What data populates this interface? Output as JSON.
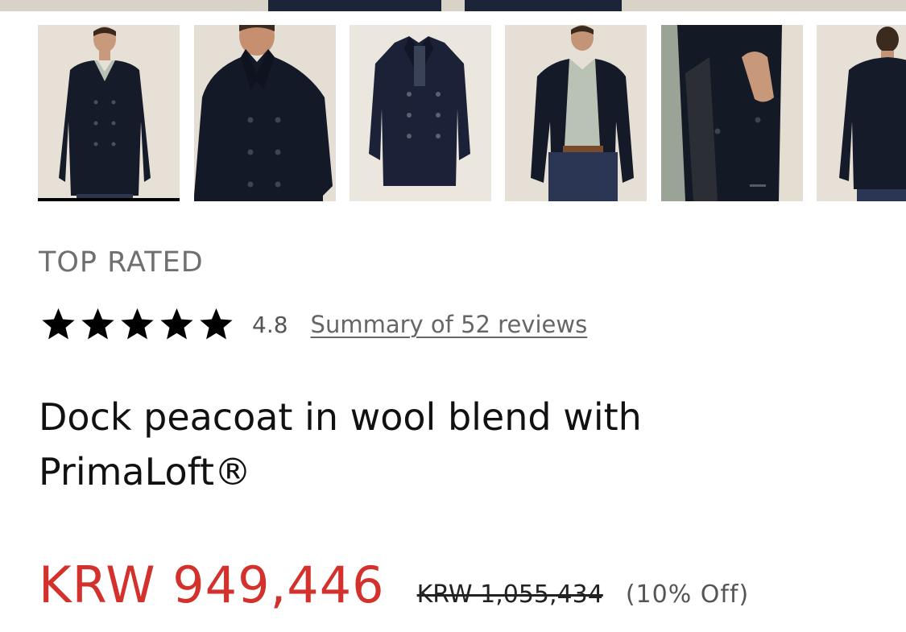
{
  "gallery": {
    "thumbnails": [
      {
        "alt": "front-view",
        "selected": true
      },
      {
        "alt": "front-closeup",
        "selected": false
      },
      {
        "alt": "flat-lay",
        "selected": false
      },
      {
        "alt": "open-front",
        "selected": false
      },
      {
        "alt": "detail-lining",
        "selected": false
      },
      {
        "alt": "back-view",
        "selected": false
      }
    ]
  },
  "product": {
    "badge": "TOP RATED",
    "rating": {
      "stars": 5,
      "value": "4.8",
      "reviews_link": "Summary of 52 reviews"
    },
    "title_line1": "Dock peacoat in wool blend with",
    "title_line2": "PrimaLoft®",
    "price": {
      "sale": "KRW 949,446",
      "original": "KRW 1,055,434",
      "discount": "(10% Off)",
      "sale_color": "#d3312b"
    }
  },
  "icons": {
    "star": "star-icon"
  }
}
